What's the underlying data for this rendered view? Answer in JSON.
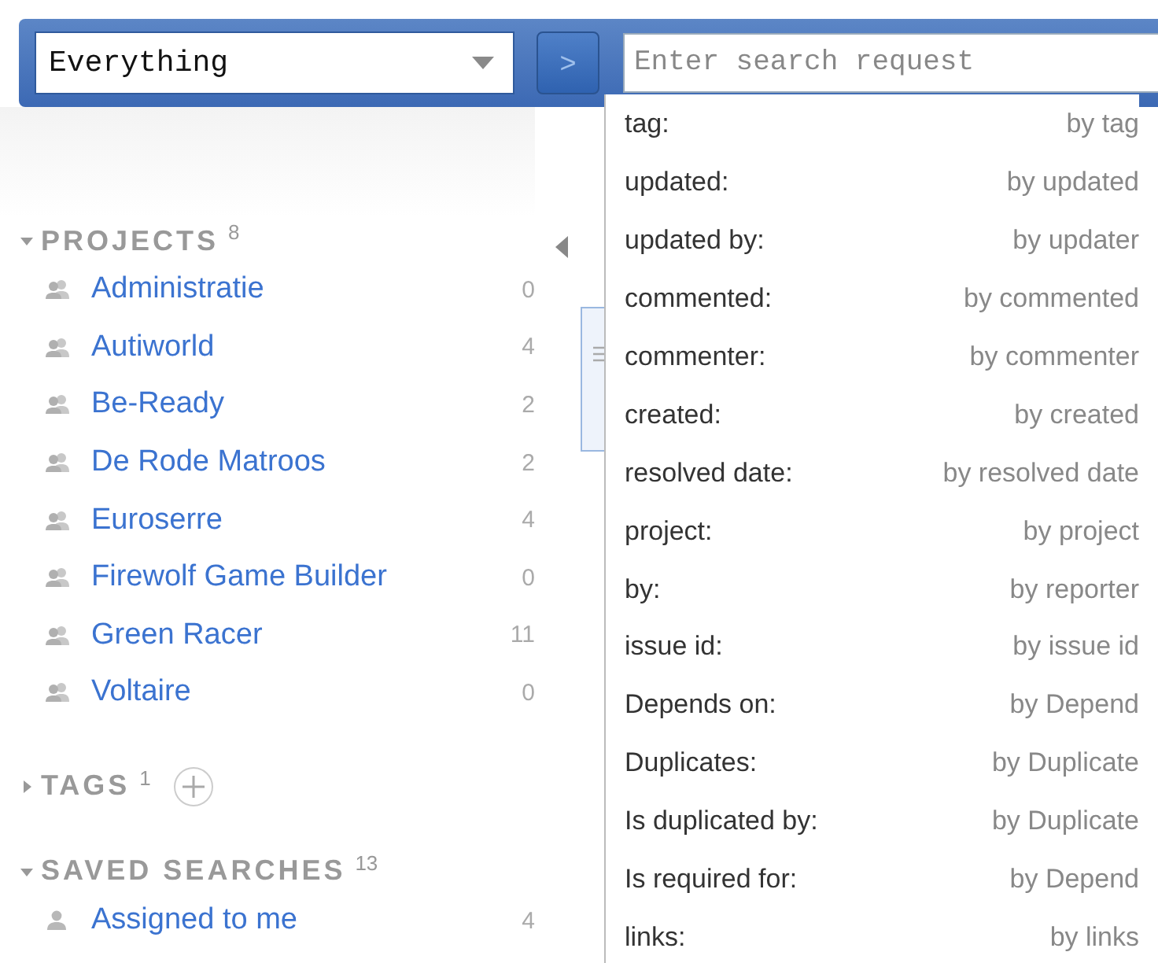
{
  "context_select": {
    "value": "Everything"
  },
  "go_button": {
    "label": ">"
  },
  "search": {
    "placeholder": "Enter search request"
  },
  "suggestions": [
    {
      "label": "tag:",
      "hint": "by tag"
    },
    {
      "label": "updated:",
      "hint": "by updated"
    },
    {
      "label": "updated by:",
      "hint": "by updater"
    },
    {
      "label": "commented:",
      "hint": "by commented"
    },
    {
      "label": "commenter:",
      "hint": "by commenter"
    },
    {
      "label": "created:",
      "hint": "by created"
    },
    {
      "label": "resolved date:",
      "hint": "by resolved date"
    },
    {
      "label": "project:",
      "hint": "by project"
    },
    {
      "label": "by:",
      "hint": "by reporter"
    },
    {
      "label": "issue id:",
      "hint": "by issue id"
    },
    {
      "label": "Depends on:",
      "hint": "by Depend"
    },
    {
      "label": "Duplicates:",
      "hint": "by Duplicate"
    },
    {
      "label": "Is duplicated by:",
      "hint": "by Duplicate"
    },
    {
      "label": "Is required for:",
      "hint": "by Depend"
    },
    {
      "label": "links:",
      "hint": "by links"
    }
  ],
  "sidebar": {
    "sections": [
      {
        "title": "PROJECTS",
        "count": "8",
        "expanded": true,
        "items": [
          {
            "kind": "group",
            "name": "Administratie",
            "count": "0"
          },
          {
            "kind": "group",
            "name": "Autiworld",
            "count": "4"
          },
          {
            "kind": "group",
            "name": "Be-Ready",
            "count": "2"
          },
          {
            "kind": "group",
            "name": "De Rode Matroos",
            "count": "2"
          },
          {
            "kind": "group",
            "name": "Euroserre",
            "count": "4"
          },
          {
            "kind": "group",
            "name": "Firewolf Game Builder",
            "count": "0"
          },
          {
            "kind": "group",
            "name": "Green Racer",
            "count": "11"
          },
          {
            "kind": "group",
            "name": "Voltaire",
            "count": "0"
          }
        ]
      },
      {
        "title": "TAGS",
        "count": "1",
        "expanded": false,
        "add_button": true
      },
      {
        "title": "SAVED SEARCHES",
        "count": "13",
        "expanded": true,
        "items": [
          {
            "kind": "user",
            "name": "Assigned to me",
            "count": "4"
          }
        ]
      }
    ]
  }
}
